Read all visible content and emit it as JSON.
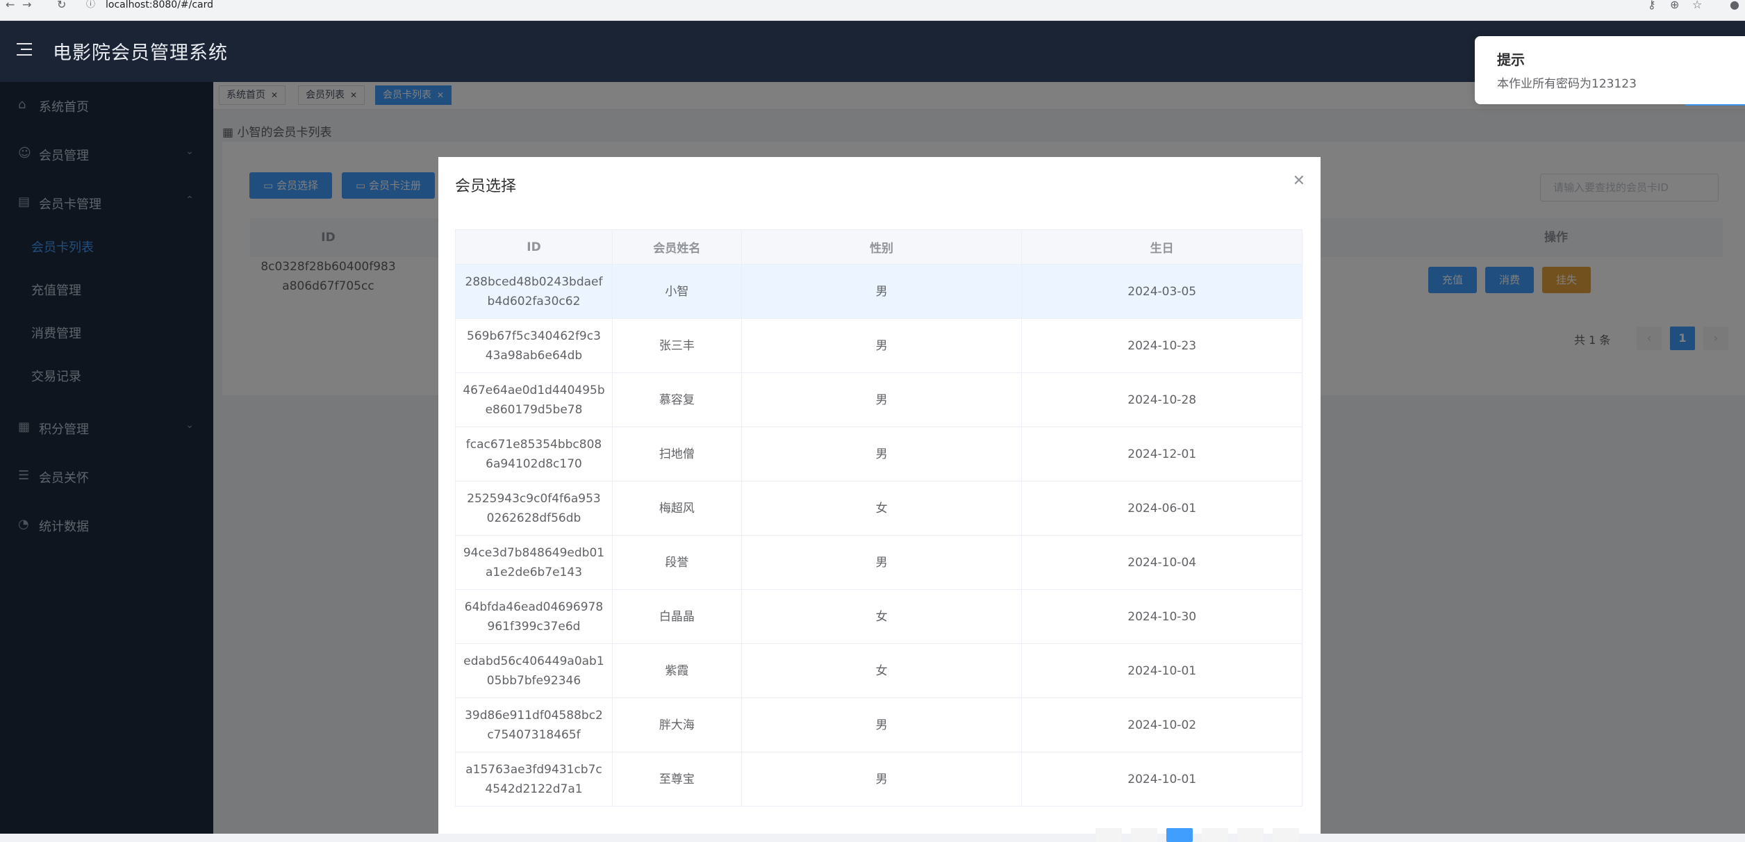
{
  "browser": {
    "url": "localhost:8080/#/card"
  },
  "header": {
    "title": "电影院会员管理系统"
  },
  "sidebar": {
    "items": [
      {
        "label": "系统首页",
        "icon": "home-icon"
      },
      {
        "label": "会员管理",
        "icon": "user-icon"
      },
      {
        "label": "会员卡管理",
        "icon": "document-icon"
      },
      {
        "label": "积分管理",
        "icon": "grid-icon"
      },
      {
        "label": "会员关怀",
        "icon": "list-icon"
      },
      {
        "label": "统计数据",
        "icon": "chart-icon"
      }
    ],
    "sub_items": [
      "会员卡列表",
      "充值管理",
      "消费管理",
      "交易记录"
    ]
  },
  "tags": [
    {
      "label": "系统首页"
    },
    {
      "label": "会员列表"
    },
    {
      "label": "会员卡列表"
    }
  ],
  "page": {
    "breadcrumb": "小智的会员卡列表",
    "buttons": {
      "select": "会员选择",
      "register": "会员卡注册"
    },
    "search_placeholder": "请输入要查找的会员卡ID",
    "columns": {
      "id": "ID",
      "ops": "操作"
    },
    "row": {
      "id_line1": "8c0328f28b60400f983",
      "id_line2": "a806d67f705cc"
    },
    "ops": {
      "recharge": "充值",
      "consume": "消费",
      "report_loss": "挂失"
    },
    "pagination": {
      "total": "共 1 条",
      "current": "1",
      "prev": "‹",
      "next": "›"
    }
  },
  "dialog": {
    "title": "会员选择",
    "columns": {
      "id": "ID",
      "name": "会员姓名",
      "gender": "性别",
      "birthday": "生日"
    },
    "rows": [
      {
        "id1": "288bced48b0243bdaef",
        "id2": "b4d602fa30c62",
        "name": "小智",
        "gender": "男",
        "birthday": "2024-03-05"
      },
      {
        "id1": "569b67f5c340462f9c3",
        "id2": "43a98ab6e64db",
        "name": "张三丰",
        "gender": "男",
        "birthday": "2024-10-23"
      },
      {
        "id1": "467e64ae0d1d440495b",
        "id2": "e860179d5be78",
        "name": "慕容复",
        "gender": "男",
        "birthday": "2024-10-28"
      },
      {
        "id1": "fcac671e85354bbc808",
        "id2": "6a94102d8c170",
        "name": "扫地僧",
        "gender": "男",
        "birthday": "2024-12-01"
      },
      {
        "id1": "2525943c9c0f4f6a953",
        "id2": "0262628df56db",
        "name": "梅超风",
        "gender": "女",
        "birthday": "2024-06-01"
      },
      {
        "id1": "94ce3d7b848649edb01",
        "id2": "a1e2de6b7e143",
        "name": "段誉",
        "gender": "男",
        "birthday": "2024-10-04"
      },
      {
        "id1": "64bfda46ead04696978",
        "id2": "961f399c37e6d",
        "name": "白晶晶",
        "gender": "女",
        "birthday": "2024-10-30"
      },
      {
        "id1": "edabd56c406449a0ab1",
        "id2": "05bb7bfe92346",
        "name": "紫霞",
        "gender": "女",
        "birthday": "2024-10-01"
      },
      {
        "id1": "39d86e911df04588bc2",
        "id2": "c75407318465f",
        "name": "胖大海",
        "gender": "男",
        "birthday": "2024-10-02"
      },
      {
        "id1": "a15763ae3fd9431cb7c",
        "id2": "4542d2122d7a1",
        "name": "至尊宝",
        "gender": "男",
        "birthday": "2024-10-01"
      }
    ]
  },
  "notification": {
    "title": "提示",
    "message": "本作业所有密码为123123"
  },
  "colors": {
    "primary": "#409eff",
    "warning": "#e6a23c",
    "sidebar": "#1f2a3c",
    "header": "#1b2434"
  }
}
